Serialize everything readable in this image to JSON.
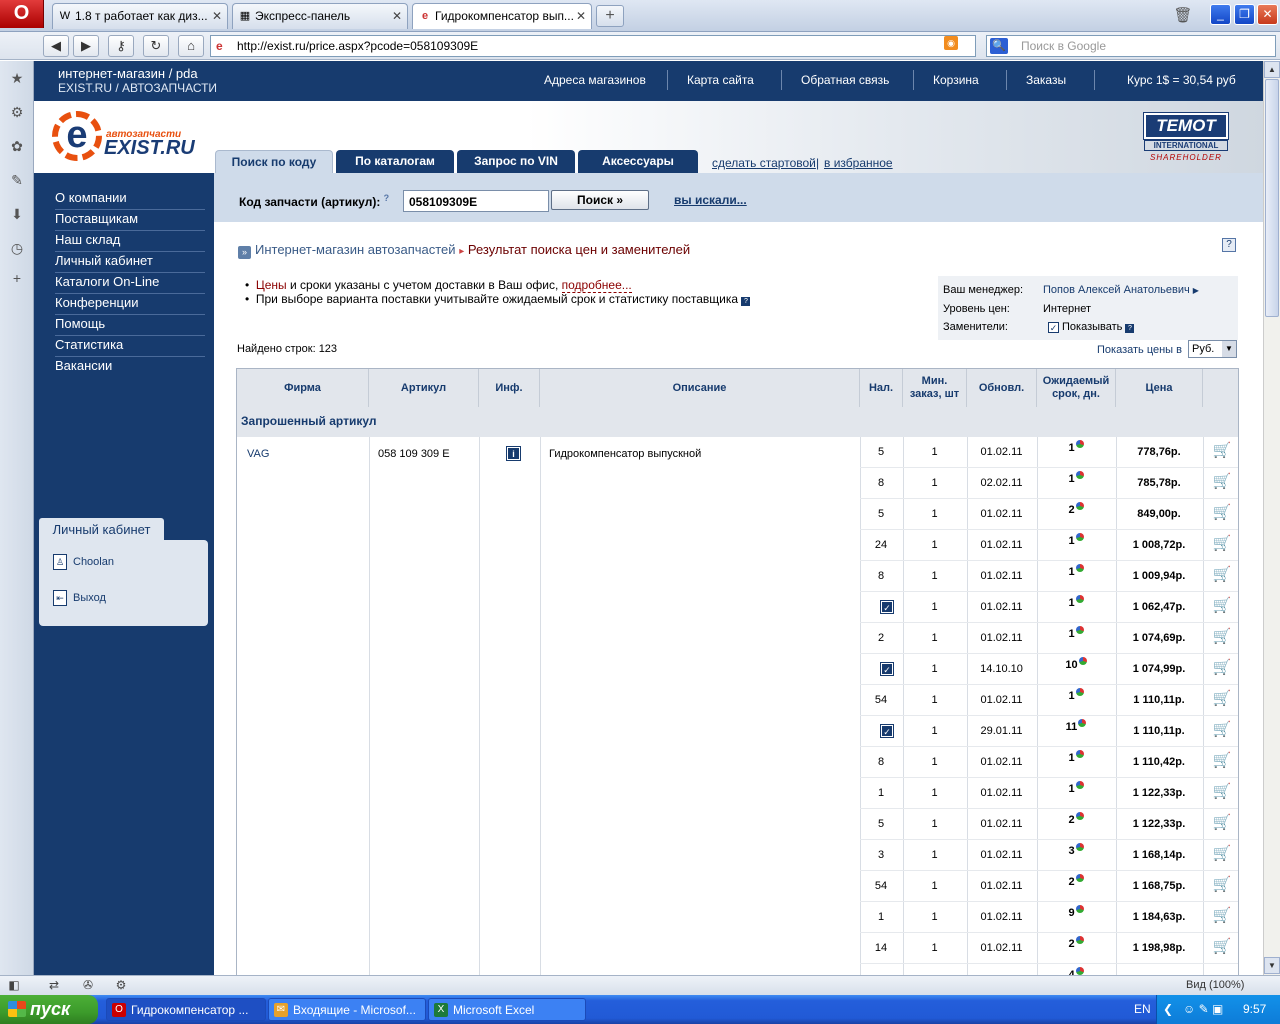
{
  "browser": {
    "tabs": [
      {
        "label": "1.8 т работает как диз...",
        "icon": "wordpress-icon"
      },
      {
        "label": "Экспресс-панель",
        "icon": "grid-icon"
      },
      {
        "label": "Гидрокомпенсатор вып...",
        "icon": "exist-icon"
      }
    ],
    "url": "http://exist.ru/price.aspx?pcode=058109309E",
    "search_placeholder": "Поиск в Google",
    "zoom": "Вид (100%)"
  },
  "site": {
    "name_line1": "интернет-магазин / pda",
    "name_line2": "EXIST.RU / АВТОЗАПЧАСТИ",
    "top_links": [
      "Адреса магазинов",
      "Карта сайта",
      "Обратная связь",
      "Корзина",
      "Заказы",
      "Курс 1$ = 30,54 руб"
    ],
    "logo_small": "автозапчасти",
    "logo_big": "EXIST.RU",
    "logo_letter": "e",
    "partner": {
      "line1": "TEMOT",
      "line2": "INTERNATIONAL",
      "line3": "SHAREHOLDER"
    }
  },
  "main_tabs": [
    "Поиск по коду",
    "По каталогам",
    "Запрос по VIN",
    "Аксессуары"
  ],
  "header_links": [
    "сделать стартовой",
    "в избранное"
  ],
  "left_nav": [
    "О компании",
    "Поставщикам",
    "Наш склад",
    "Личный кабинет",
    "Каталоги On-Line",
    "Конференции",
    "Помощь",
    "Статистика",
    "Вакансии"
  ],
  "cabinet": {
    "title": "Личный кабинет",
    "user": "Choolan",
    "logout": "Выход"
  },
  "search": {
    "label": "Код запчасти (артикул):",
    "hint": "?",
    "value": "058109309E",
    "button": "Поиск »",
    "link": "вы искали..."
  },
  "breadcrumb": {
    "link": "Интернет-магазин автозапчастей",
    "current": "Результат поиска цен и заменителей"
  },
  "notes": {
    "line1_red": "Цены",
    "line1_text": " и сроки указаны с учетом доставки в Ваш офис, ",
    "line1_link": "подробнее...",
    "line2": "При выборе варианта поставки учитывайте ожидаемый срок и статистику поставщика"
  },
  "manager": {
    "manager_label": "Ваш менеджер:",
    "manager_value": "Попов Алексей Анатольевич",
    "level_label": "Уровень цен:",
    "level_value": "Интернет",
    "substitutes_label": "Заменители:",
    "substitutes_value": "Показывать"
  },
  "found": "Найдено строк: 123",
  "price_currency_label": "Показать цены в",
  "price_currency": "Руб.",
  "table": {
    "headers": [
      "Фирма",
      "Артикул",
      "Инф.",
      "Описание",
      "Нал.",
      "Мин. заказ, шт",
      "Обновл.",
      "Ожидаемый срок, дн.",
      "Цена"
    ],
    "group": "Запрошенный артикул",
    "firm": "VAG",
    "article": "058 109 309 E",
    "description": "Гидрокомпенсатор выпускной",
    "rows": [
      {
        "qty": "5",
        "min": "1",
        "upd": "01.02.11",
        "days": "1",
        "price": "778,76р."
      },
      {
        "qty": "8",
        "min": "1",
        "upd": "02.02.11",
        "days": "1",
        "price": "785,78р."
      },
      {
        "qty": "5",
        "min": "1",
        "upd": "01.02.11",
        "days": "2",
        "price": "849,00р."
      },
      {
        "qty": "24",
        "min": "1",
        "upd": "01.02.11",
        "days": "1",
        "price": "1 008,72р."
      },
      {
        "qty": "8",
        "min": "1",
        "upd": "01.02.11",
        "days": "1",
        "price": "1 009,94р."
      },
      {
        "qty": "",
        "check": true,
        "min": "1",
        "upd": "01.02.11",
        "days": "1",
        "price": "1 062,47р."
      },
      {
        "qty": "2",
        "min": "1",
        "upd": "01.02.11",
        "days": "1",
        "price": "1 074,69р."
      },
      {
        "qty": "",
        "check": true,
        "min": "1",
        "upd": "14.10.10",
        "days": "10",
        "price": "1 074,99р."
      },
      {
        "qty": "54",
        "min": "1",
        "upd": "01.02.11",
        "days": "1",
        "price": "1 110,11р."
      },
      {
        "qty": "",
        "check": true,
        "min": "1",
        "upd": "29.01.11",
        "days": "11",
        "price": "1 110,11р."
      },
      {
        "qty": "8",
        "min": "1",
        "upd": "01.02.11",
        "days": "1",
        "price": "1 110,42р."
      },
      {
        "qty": "1",
        "min": "1",
        "upd": "01.02.11",
        "days": "1",
        "price": "1 122,33р."
      },
      {
        "qty": "5",
        "min": "1",
        "upd": "01.02.11",
        "days": "2",
        "price": "1 122,33р."
      },
      {
        "qty": "3",
        "min": "1",
        "upd": "01.02.11",
        "days": "3",
        "price": "1 168,14р."
      },
      {
        "qty": "54",
        "min": "1",
        "upd": "01.02.11",
        "days": "2",
        "price": "1 168,75р."
      },
      {
        "qty": "1",
        "min": "1",
        "upd": "01.02.11",
        "days": "9",
        "price": "1 184,63р."
      },
      {
        "qty": "14",
        "min": "1",
        "upd": "01.02.11",
        "days": "2",
        "price": "1 198,98р."
      },
      {
        "qty": "",
        "min": "",
        "upd": "",
        "days": "4",
        "price": ""
      }
    ]
  },
  "taskbar": {
    "start": "пуск",
    "tasks": [
      "Гидрокомпенсатор ...",
      "Входящие - Microsof...",
      "Microsoft Excel"
    ],
    "lang": "EN",
    "clock": "9:57"
  }
}
